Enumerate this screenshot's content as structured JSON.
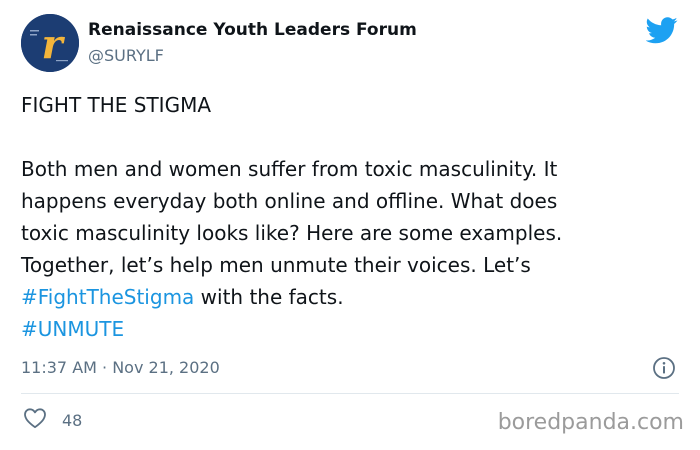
{
  "author": {
    "name": "Renaissance Youth Leaders Forum",
    "handle": "@SURYLF",
    "avatar_letter": "r"
  },
  "tweet": {
    "lines": [
      "FIGHT THE STIGMA",
      "Both men and women suffer from toxic masculinity. It",
      "happens everyday both online and offline. What does",
      "toxic masculinity looks like? Here are some examples.",
      "Together, let’s help men unmute their voices. Let’s"
    ],
    "hashtag_1": "#FightTheStigma",
    "after_hashtag_1": " with the facts.",
    "hashtag_2": "#UNMUTE"
  },
  "meta": {
    "timestamp": "11:37 AM · Nov 21, 2020",
    "like_count": "48"
  },
  "watermark": "boredpanda.com",
  "colors": {
    "link": "#1b95e0",
    "twitter_blue": "#1da1f2",
    "secondary_text": "#5b7083",
    "avatar_bg": "#1c3d73",
    "avatar_letter": "#f3b53b"
  },
  "icons": {
    "brand": "twitter-bird-icon",
    "info": "info-icon",
    "like": "heart-icon"
  }
}
